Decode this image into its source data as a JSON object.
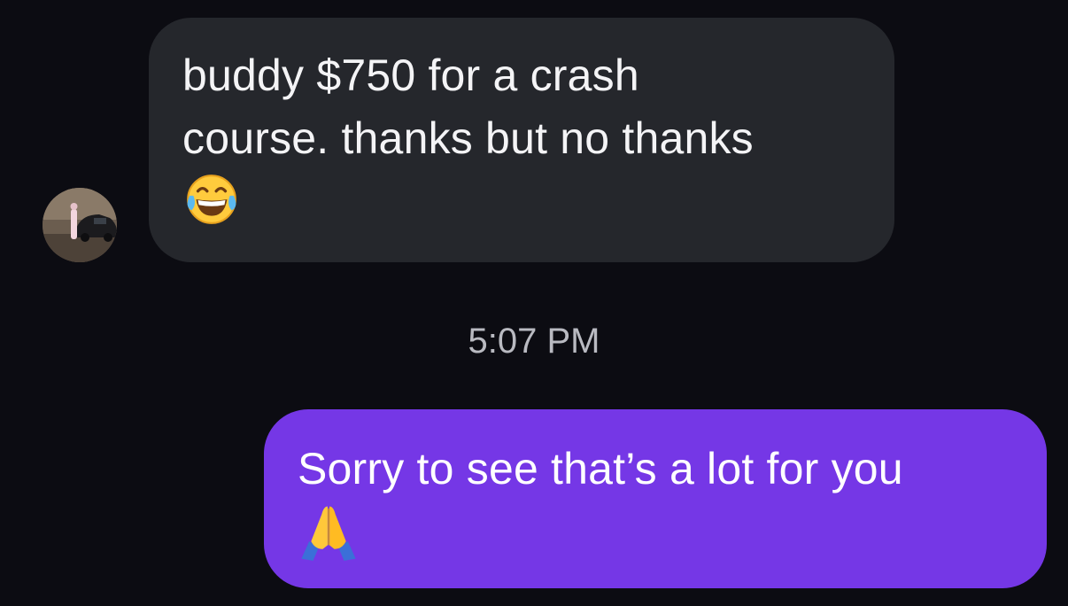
{
  "conversation": {
    "incoming": {
      "text": "buddy $750 for a crash\ncourse. thanks but no thanks",
      "emoji": "face-with-tears-of-joy",
      "avatar": "contact-avatar-photo"
    },
    "timestamp": "5:07 PM",
    "outgoing": {
      "text": "Sorry to see that’s a lot for you",
      "emoji": "folded-hands"
    }
  },
  "colors": {
    "background": "#0c0c12",
    "incoming_bubble": "#25272c",
    "outgoing_bubble": "#7537e6",
    "timestamp_text": "#b9bac1"
  }
}
